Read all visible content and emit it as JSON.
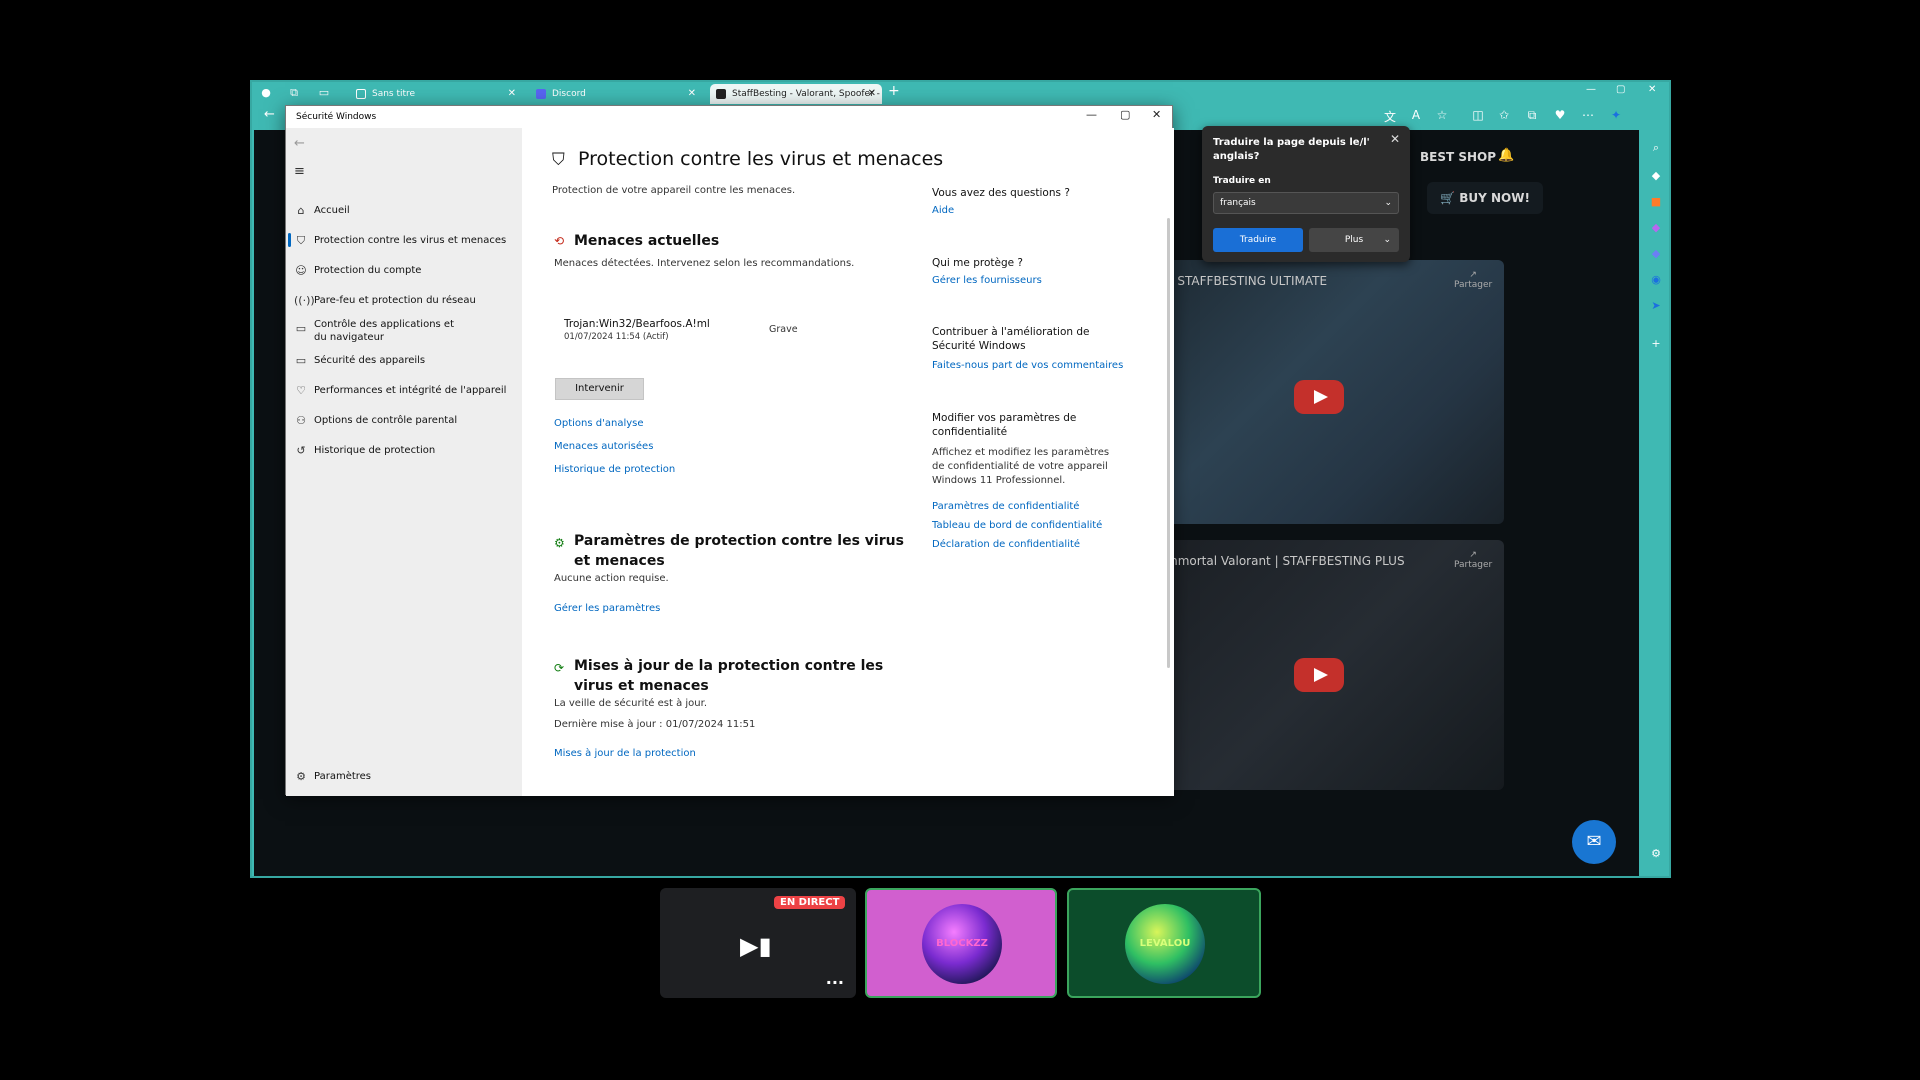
{
  "browser": {
    "tabs": [
      {
        "label": "Sans titre"
      },
      {
        "label": "Discord"
      },
      {
        "label": "StaffBesting - Valorant, Spoofer -"
      }
    ],
    "new_tab": "+"
  },
  "site": {
    "best_shop": "BEST SHOP",
    "buy_now": "BUY NOW!",
    "card1_title": "n STAFFBESTING ULTIMATE",
    "card2_title": "mmortal Valorant | STAFFBESTING PLUS",
    "share": "Partager"
  },
  "translate": {
    "title": "Traduire la page depuis le/l' anglais?",
    "label": "Traduire en",
    "selected": "français",
    "primary": "Traduire",
    "more": "Plus"
  },
  "winsec": {
    "title": "Sécurité Windows",
    "nav": [
      {
        "label": "Accueil"
      },
      {
        "label": "Protection contre les virus et menaces"
      },
      {
        "label": "Protection du compte"
      },
      {
        "label": "Pare-feu et protection du réseau"
      },
      {
        "label": "Contrôle des applications et du navigateur"
      },
      {
        "label": "Sécurité des appareils"
      },
      {
        "label": "Performances et intégrité de l'appareil"
      },
      {
        "label": "Options de contrôle parental"
      },
      {
        "label": "Historique de protection"
      }
    ],
    "settings": "Paramètres",
    "main": {
      "title": "Protection contre les virus et menaces",
      "subtitle": "Protection de votre appareil contre les menaces.",
      "threats_title": "Menaces actuelles",
      "threats_sub": "Menaces détectées. Intervenez selon les recommandations.",
      "threat_name": "Trojan:Win32/Bearfoos.A!ml",
      "threat_date": "01/07/2024 11:54 (Actif)",
      "threat_severity": "Grave",
      "intervene": "Intervenir",
      "link_scan": "Options d'analyse",
      "link_allowed": "Menaces autorisées",
      "link_history": "Historique de protection",
      "settings_title": "Paramètres de protection contre les virus et menaces",
      "settings_sub": "Aucune action requise.",
      "settings_link": "Gérer les paramètres",
      "updates_title": "Mises à jour de la protection contre les virus et menaces",
      "updates_sub1": "La veille de sécurité est à jour.",
      "updates_sub2": "Dernière mise à jour : 01/07/2024 11:51",
      "updates_link": "Mises à jour de la protection"
    },
    "side": {
      "q_title": "Vous avez des questions ?",
      "q_link": "Aide",
      "who_title": "Qui me protège ?",
      "who_link": "Gérer les fournisseurs",
      "contrib_title": "Contribuer à l'amélioration de Sécurité Windows",
      "contrib_link": "Faites-nous part de vos commentaires",
      "privacy_title": "Modifier vos paramètres de confidentialité",
      "privacy_text": "Affichez et modifiez les paramètres de confidentialité de votre appareil Windows 11 Professionnel.",
      "privacy_link1": "Paramètres de confidentialité",
      "privacy_link2": "Tableau de bord de confidentialité",
      "privacy_link3": "Déclaration de confidentialité"
    }
  },
  "call": {
    "live_badge": "EN DIRECT",
    "user2": "BLOCKZZ",
    "user3": "LEVALOU"
  }
}
